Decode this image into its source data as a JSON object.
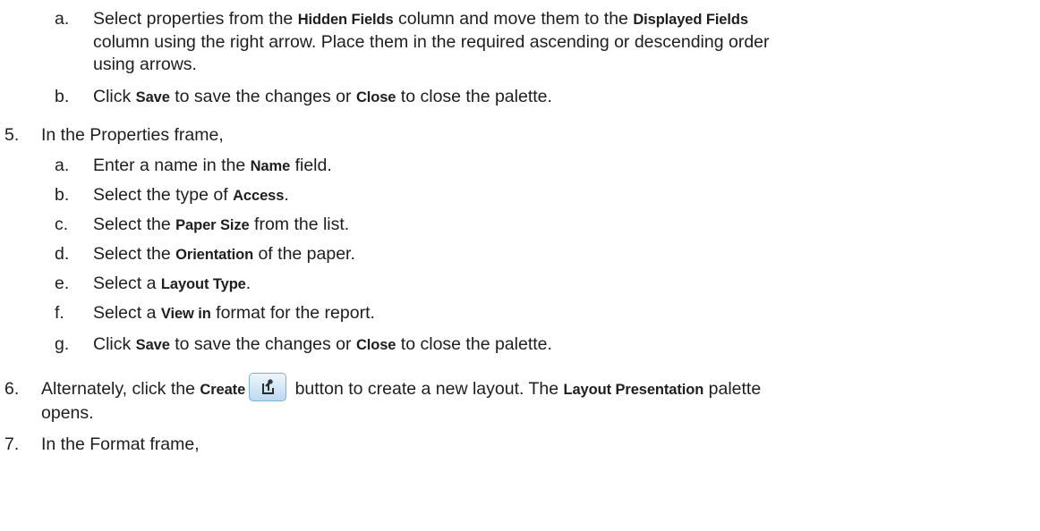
{
  "rows": {
    "a1": {
      "marker": "a.",
      "line1": {
        "t1": "Select properties from the ",
        "b1": "Hidden Fields",
        "t2": " column and move them to the ",
        "b2": "Displayed Fields"
      },
      "line2": "column using the right arrow. Place them in the required ascending or descending order",
      "line3": "using arrows."
    },
    "b1": {
      "marker": "b.",
      "t1": "Click ",
      "b1": "Save",
      "t2": " to save the changes or ",
      "b2": "Close",
      "t3": " to close the palette."
    },
    "s5": {
      "marker": "5.",
      "text": "In the Properties frame,"
    },
    "s5a": {
      "marker": "a.",
      "t1": "Enter a name in the ",
      "b1": "Name",
      "t2": " field."
    },
    "s5b": {
      "marker": "b.",
      "t1": "Select the type of ",
      "b1": "Access",
      "t2": "."
    },
    "s5c": {
      "marker": "c.",
      "t1": "Select the ",
      "b1": "Paper Size",
      "t2": " from the list."
    },
    "s5d": {
      "marker": "d.",
      "t1": "Select the ",
      "b1": "Orientation",
      "t2": " of the paper."
    },
    "s5e": {
      "marker": "e.",
      "t1": "Select a ",
      "b1": "Layout Type",
      "t2": "."
    },
    "s5f": {
      "marker": "f.",
      "t1": "Select a ",
      "b1": "View in",
      "t2": " format for the report."
    },
    "s5g": {
      "marker": "g.",
      "t1": "Click ",
      "b1": "Save",
      "t2": " to save the changes or ",
      "b2": "Close",
      "t3": " to close the palette."
    },
    "s6": {
      "marker": "6.",
      "t1": "Alternately, click the ",
      "b1": "Create",
      "t2": " button to create a new layout. The ",
      "b2": "Layout Presentation",
      "t3": " palette",
      "line2": "opens.",
      "icon": "create-layout-icon"
    },
    "s7": {
      "marker": "7.",
      "text": "In the Format frame,"
    }
  }
}
